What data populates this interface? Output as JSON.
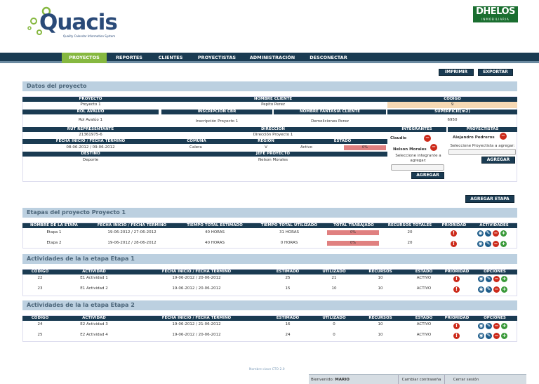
{
  "brand": {
    "logo_word": "Quacis",
    "logo_tagline": "Quality Calendar Information System",
    "partner_logo": "DHELOS",
    "partner_sub": "INMOBILIARIA"
  },
  "nav": {
    "items": [
      "PROYECTOS",
      "REPORTES",
      "CLIENTES",
      "PROYECTISTAS",
      "ADMINISTRACIÓN",
      "DESCONECTAR"
    ],
    "active": "PROYECTOS"
  },
  "toolbar": {
    "print": "IMPRIMIR",
    "export": "EXPORTAR"
  },
  "project": {
    "section_title": "Datos del proyecto",
    "labels": {
      "proyecto": "PROYECTO",
      "nombre_cliente": "NOMBRE CLIENTE",
      "codigo": "CODIGO",
      "rol_avaluo": "ROL AVALÚO",
      "inscripcion_cbr": "INSCRIPCIÓN CBR",
      "nombre_fantasia": "NOMBRE FANTASÍA CLIENTE",
      "superficie": "SUPERFICIE(m2)",
      "rut_representante": "RUT REPRESENTANTE",
      "direccion": "DIRECCION",
      "integrantes": "INTEGRANTES",
      "proyectistas": "PROYECTISTAS",
      "fecha": "FECHA INICIO / FECHA TERMINO",
      "comuna": "COMUNA",
      "region": "REGION",
      "estado": "ESTADO",
      "destino": "DESTINO",
      "jefe_proyecto": "JEFE PROYECTO"
    },
    "values": {
      "proyecto": "Proyecto 1",
      "nombre_cliente": "Pepito Perez",
      "codigo": "9",
      "rol_avaluo": "Rol Avalúo 1",
      "inscripcion_cbr": "Inscripción Proyecto 1",
      "nombre_fantasia": "Demoliciones Perez",
      "superficie": "6950",
      "rut_representante": "21361975-6",
      "direccion": "Dirección Proyecto 1",
      "fecha": "08-06-2012 / 09-06-2012",
      "comuna": "Calera",
      "region": "V",
      "estado": "Activo",
      "estado_progress": "0%",
      "destino": "Deporte",
      "jefe_proyecto": "Nelson Morales"
    },
    "integrantes": [
      "Claudio",
      "Nelson Morales"
    ],
    "integrante_select_label": "Seleccione integrante a agregar:",
    "proyectistas": [
      "Alejandro Pedreros"
    ],
    "proyectista_select_label": "Seleccione Proyectista a agregar:",
    "add_label": "AGREGAR"
  },
  "add_stage_button": "AGREGAR ETAPA",
  "stages": {
    "section_title": "Etapas del proyecto Proyecto 1",
    "headers": [
      "NOMBRE DE LA ETAPA",
      "FECHA INICIO / FECHA TERMINO",
      "TIEMPO TOTAL ESTIMADO",
      "TIEMPO TOTAL UTILIZADO",
      "TOTAL TRABAJADO",
      "RECURSOS TOTALES",
      "PRIORIDAD",
      "ACTIVIDADES"
    ],
    "rows": [
      {
        "name": "Etapa 1",
        "dates": "19-06-2012 / 27-06-2012",
        "est": "40 HORAS",
        "used": "31 HORAS",
        "worked": "0%",
        "res": "20"
      },
      {
        "name": "Etapa 2",
        "dates": "19-06-2012 / 28-06-2012",
        "est": "40 HORAS",
        "used": "0 HORAS",
        "worked": "0%",
        "res": "20"
      }
    ]
  },
  "act1": {
    "section_title": "Actividades de la la etapa Etapa 1",
    "headers": [
      "CODIGO",
      "ACTIVIDAD",
      "FECHA INICIO / FECHA TERMINO",
      "ESTIMADO",
      "UTILIZADO",
      "RECURSOS",
      "ESTADO",
      "PRIORIDAD",
      "OPCIONES"
    ],
    "rows": [
      {
        "code": "22",
        "name": "E1 Actividad 1",
        "dates": "19-06-2012 / 20-06-2012",
        "est": "25",
        "used": "21",
        "res": "10",
        "state": "ACTIVO"
      },
      {
        "code": "23",
        "name": "E1 Actividad 2",
        "dates": "19-06-2012 / 20-06-2012",
        "est": "15",
        "used": "10",
        "res": "10",
        "state": "ACTIVO"
      }
    ]
  },
  "act2": {
    "section_title": "Actividades de la la etapa Etapa 2",
    "headers": [
      "CODIGO",
      "ACTIVIDAD",
      "FECHA INICIO / FECHA TERMINO",
      "ESTIMADO",
      "UTILIZADO",
      "RECURSOS",
      "ESTADO",
      "PRIORIDAD",
      "OPCIONES"
    ],
    "rows": [
      {
        "code": "24",
        "name": "E2 Actividad 3",
        "dates": "19-06-2012 / 21-06-2012",
        "est": "16",
        "used": "0",
        "res": "10",
        "state": "ACTIVO"
      },
      {
        "code": "25",
        "name": "E2 Actividad 4",
        "dates": "19-06-2012 / 20-06-2012",
        "est": "24",
        "used": "0",
        "res": "10",
        "state": "ACTIVO"
      }
    ]
  },
  "footer": {
    "note": "Nombre clave CTO 2.0"
  },
  "statusbar": {
    "welcome": "Bienvenido:",
    "user": "MARIO",
    "change_pw": "Cambiar contraseña",
    "logout": "Cerrar sesión"
  },
  "colors": {
    "nav": "#1a3b52",
    "active_nav": "#86b840",
    "section": "#bcd0e0",
    "progress": "#e08080",
    "codigo_highlight": "#f6d9b4"
  },
  "icons": {
    "priority": "priority-red-icon",
    "view": "view-icon",
    "edit": "edit-icon",
    "delete": "delete-icon",
    "add": "add-icon",
    "remove": "remove-member-icon"
  }
}
